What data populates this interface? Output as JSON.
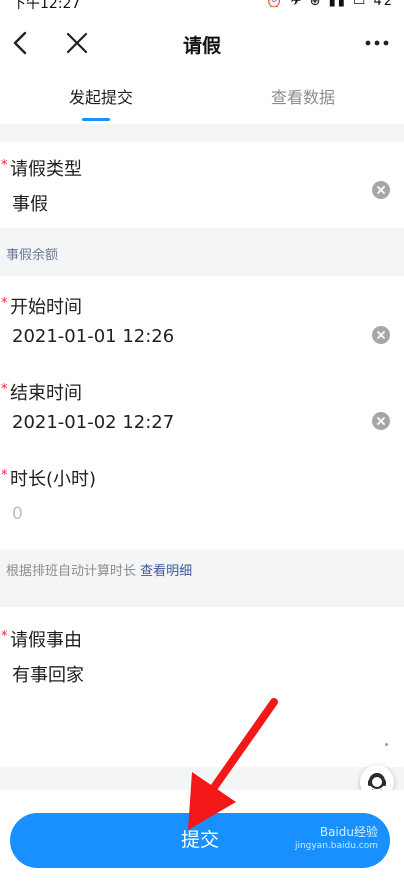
{
  "status_bar": {
    "time": "下午12:27",
    "icons": "⏰ ✈ ⊕ ▮▮ ▭ 42"
  },
  "navbar": {
    "title": "请假"
  },
  "tabs": [
    {
      "label": "发起提交"
    },
    {
      "label": "查看数据"
    }
  ],
  "form": {
    "leave_type": {
      "label": "请假类型",
      "value": "事假"
    },
    "balance_hint": "事假余额",
    "start_time": {
      "label": "开始时间",
      "value": "2021-01-01 12:26"
    },
    "end_time": {
      "label": "结束时间",
      "value": "2021-01-02 12:27"
    },
    "duration": {
      "label": "时长(小时)",
      "placeholder": "0"
    },
    "duration_hint": "根据排班自动计算时长",
    "duration_link": "查看明细",
    "reason": {
      "label": "请假事由",
      "value": "有事回家"
    },
    "required_mark": "*"
  },
  "submit": {
    "label": "提交"
  },
  "watermark": {
    "brand": "Baidu经验",
    "url": "jingyan.baidu.com"
  },
  "colors": {
    "accent": "#1890ff",
    "required": "#f5222d",
    "arrow": "#f21818"
  }
}
